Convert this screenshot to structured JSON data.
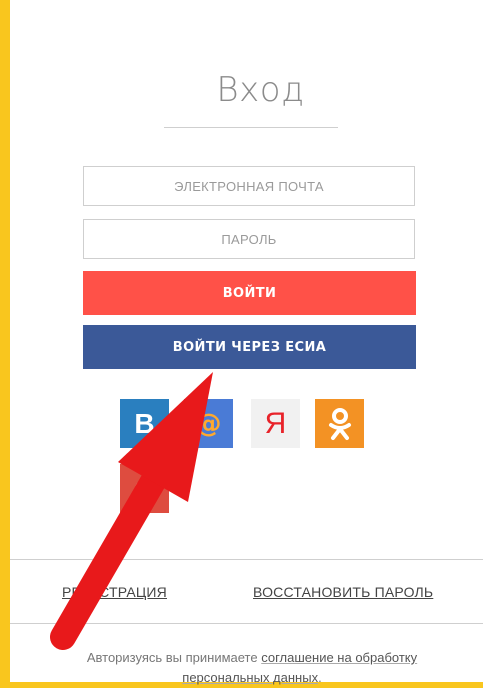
{
  "title": "Вход",
  "form": {
    "email_placeholder": "ЭЛЕКТРОННАЯ ПОЧТА",
    "password_placeholder": "ПАРОЛЬ",
    "login_label": "ВОЙТИ",
    "esia_label": "ВОЙТИ ЧЕРЕЗ ЕСИА"
  },
  "social": {
    "vk_glyph": "В",
    "mail_glyph": "@",
    "yandex_glyph": "Я"
  },
  "links": {
    "register": "РЕГИСТРАЦИЯ",
    "restore": "ВОССТАНОВИТЬ ПАРОЛЬ"
  },
  "agreement": {
    "prefix": "Авторизуясь вы принимаете ",
    "link": "соглашение на обработку персональных данных",
    "suffix": "."
  },
  "colors": {
    "background": "#f9c61e",
    "login_button": "#ff5148",
    "esia_button": "#3b5998",
    "vk": "#2a7fbf",
    "mail": "#4a7bd6",
    "yandex": "#f1f1f1",
    "ok": "#f39224",
    "google": "#de4c3f",
    "arrow": "#e8191b"
  }
}
